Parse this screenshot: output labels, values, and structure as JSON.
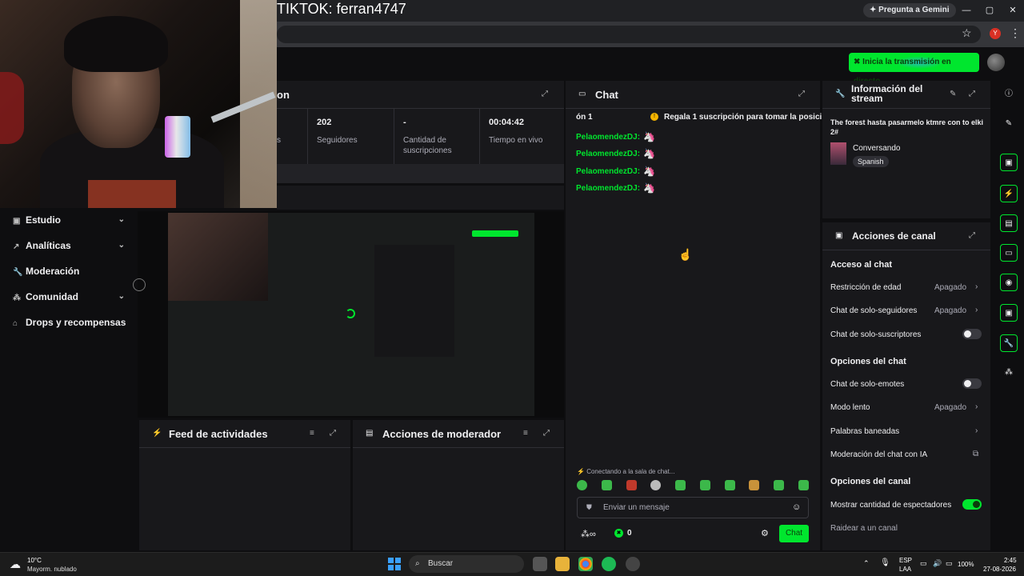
{
  "window": {
    "title": "TIKTOK: ferran4747",
    "gemini": "Pregunta a Gemini",
    "minimize": "—",
    "maximize": "▢",
    "close": "✕",
    "star": "☆",
    "profile_letter": "Y",
    "menu": "⋮"
  },
  "topbar": {
    "go_live_label": "Inicia la transmisión en directo"
  },
  "sidebar": {
    "items": [
      {
        "label": "Estudio",
        "has_chevron": true
      },
      {
        "label": "Analíticas",
        "has_chevron": true
      },
      {
        "label": "Moderación",
        "has_chevron": false
      },
      {
        "label": "Comunidad",
        "has_chevron": true
      },
      {
        "label": "Drops y recompensas",
        "has_chevron": false
      }
    ]
  },
  "stats": {
    "title_partial": "on",
    "col1_label_partial": "s",
    "followers": {
      "value": "202",
      "label": "Seguidores"
    },
    "subs": {
      "value": "-",
      "label": "Cantidad de suscripciones"
    },
    "time": {
      "value": "00:04:42",
      "label": "Tiempo en vivo"
    }
  },
  "feed": {
    "title": "Feed de actividades"
  },
  "mod_actions": {
    "title": "Acciones de moderador"
  },
  "chat": {
    "title": "Chat",
    "pinned_left": "ón 1",
    "pinned_text": "Regala 1 suscripción para tomar la posici",
    "messages": [
      {
        "user": "PelaomendezDJ:",
        "emote": "🦄"
      },
      {
        "user": "PelaomendezDJ:",
        "emote": "🦄"
      },
      {
        "user": "PelaomendezDJ:",
        "emote": "🦄"
      },
      {
        "user": "PelaomendezDJ:",
        "emote": "🦄"
      }
    ],
    "connecting": "Conectando a la sala de chat...",
    "input_placeholder": "Enviar un mensaje",
    "points_value": "0",
    "infinity": "∞",
    "send_label": "Chat"
  },
  "stream_info": {
    "title": "Información del stream",
    "stream_title": "The forest hasta pasarmelo ktmre con to elki 2#",
    "category": "Conversando",
    "tag": "Spanish"
  },
  "channel_actions": {
    "title": "Acciones de canal",
    "section_chat_access": "Acceso al chat",
    "age_restriction": {
      "label": "Restricción de edad",
      "value": "Apagado"
    },
    "followers_only": {
      "label": "Chat de solo-seguidores",
      "value": "Apagado"
    },
    "subs_only": {
      "label": "Chat de solo-suscriptores",
      "on": false
    },
    "section_chat_options": "Opciones del chat",
    "emote_only": {
      "label": "Chat de solo-emotes",
      "on": false
    },
    "slow_mode": {
      "label": "Modo lento",
      "value": "Apagado"
    },
    "banned_words": {
      "label": "Palabras baneadas"
    },
    "ai_moderation": {
      "label": "Moderación del chat con IA"
    },
    "section_channel_options": "Opciones del canal",
    "show_viewers": {
      "label": "Mostrar cantidad de espectadores",
      "on": true
    },
    "raid": {
      "label": "Raidear a un canal"
    }
  },
  "taskbar": {
    "weather_temp": "10°C",
    "weather_desc": "Mayorm. nublado",
    "search_label": "Buscar",
    "lang_top": "ESP",
    "lang_bottom": "LAA",
    "battery": "100%",
    "time": "2:45",
    "date": "27-08-2026"
  },
  "colors": {
    "accent": "#00e62e",
    "panel": "#18181b",
    "bg": "#0e0e10"
  }
}
